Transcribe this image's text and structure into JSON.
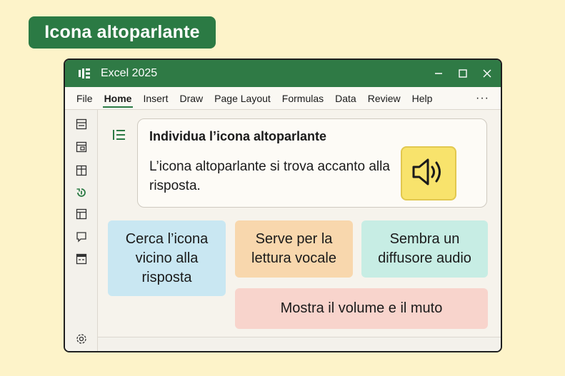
{
  "badge": {
    "label": "Icona altoparlante"
  },
  "window": {
    "title": "Excel 2025",
    "logo_icon": "excel-logo-icon",
    "controls": [
      "minimize-icon",
      "maximize-icon",
      "close-icon"
    ]
  },
  "menu": {
    "items": [
      {
        "label": "File"
      },
      {
        "label": "Home",
        "active": true
      },
      {
        "label": "Insert"
      },
      {
        "label": "Draw"
      },
      {
        "label": "Page Layout"
      },
      {
        "label": "Formulas"
      },
      {
        "label": "Data"
      },
      {
        "label": "Review"
      },
      {
        "label": "Help"
      }
    ],
    "more": "···"
  },
  "sidebar": {
    "icons": [
      "layout-icon",
      "template-icon",
      "grid-icon",
      "refresh-icon",
      "panel-icon",
      "comment-icon",
      "form-icon"
    ],
    "settings_icon": "settings-icon"
  },
  "card": {
    "title": "Individua l’icona altoparlante",
    "body": "L’icona altoparlante si trova accanto alla risposta.",
    "speaker_icon": "speaker-icon"
  },
  "tiles": [
    {
      "label": "Cerca l’icona vicino alla risposta",
      "color": "#c9e7f2"
    },
    {
      "label": "Serve per la lettura vocale",
      "color": "#f8d7ad"
    },
    {
      "label": "Sembra un diffusore audio",
      "color": "#c7ede4"
    },
    {
      "label": "Mostra il volume e il muto",
      "color": "#f8d4cc"
    }
  ],
  "colors": {
    "accent": "#2b7a44",
    "titlebar": "#2f7a45",
    "background": "#fdf3c9",
    "speaker": "#f8e36c"
  }
}
